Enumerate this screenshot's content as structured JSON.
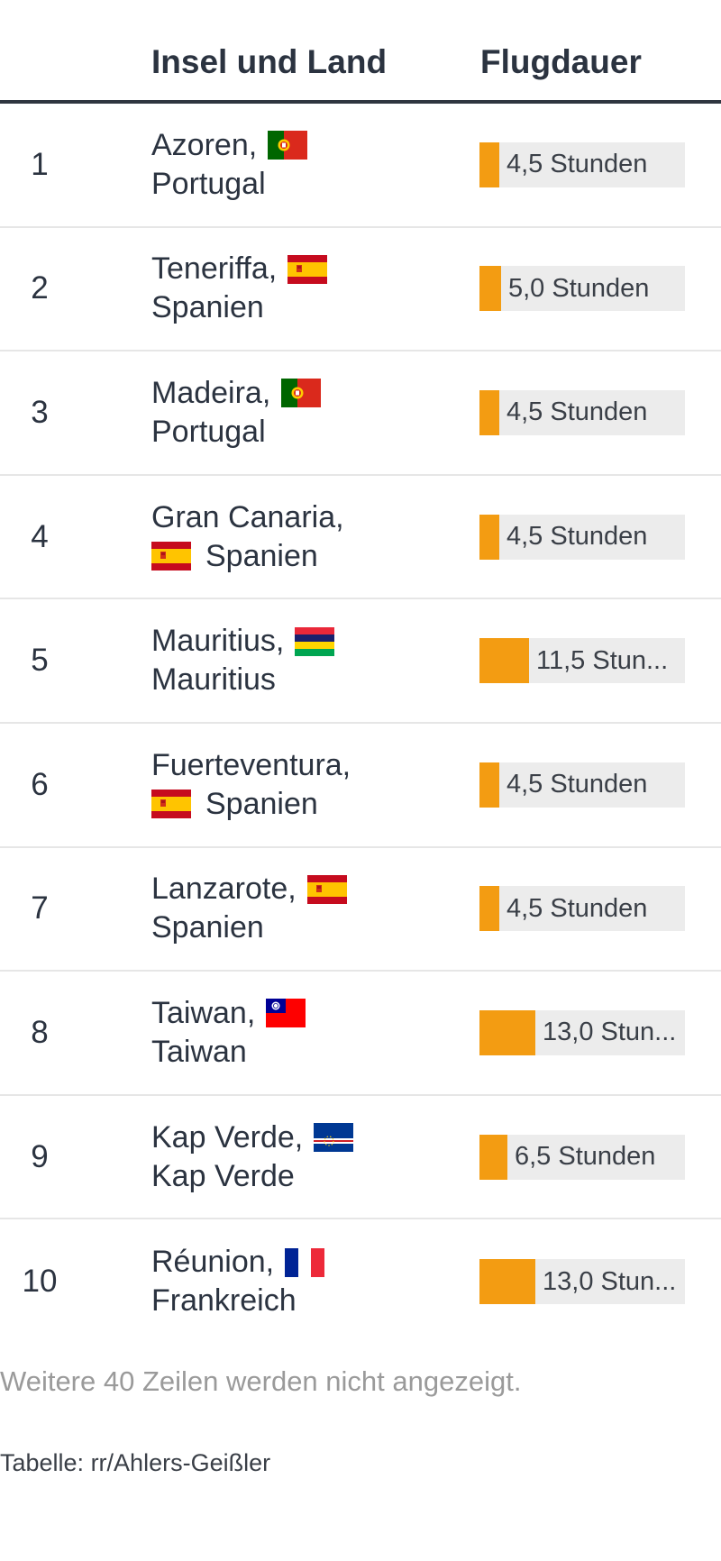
{
  "header": {
    "col_name": "Insel und Land",
    "col_duration": "Flugdauer"
  },
  "colors": {
    "bar": "#f39c12",
    "track": "#ececec"
  },
  "rows": [
    {
      "rank": "1",
      "island": "Azoren,",
      "country": "Portugal",
      "flag": "pt-flag-icon",
      "duration_hours": 4.5,
      "label": "4,5 Stunden"
    },
    {
      "rank": "2",
      "island": "Teneriffa,",
      "country": "Spanien",
      "flag": "es-flag-icon",
      "duration_hours": 5.0,
      "label": "5,0 Stunden"
    },
    {
      "rank": "3",
      "island": "Madeira,",
      "country": "Portugal",
      "flag": "pt-flag-icon",
      "duration_hours": 4.5,
      "label": "4,5 Stunden"
    },
    {
      "rank": "4",
      "island": "Gran Canaria,",
      "country": "Spanien",
      "flag": "es-flag-icon",
      "duration_hours": 4.5,
      "label": "4,5 Stunden"
    },
    {
      "rank": "5",
      "island": "Mauritius,",
      "country": "Mauritius",
      "flag": "mu-flag-icon",
      "duration_hours": 11.5,
      "label": "11,5 Stun..."
    },
    {
      "rank": "6",
      "island": "Fuerteventura,",
      "country": "Spanien",
      "flag": "es-flag-icon",
      "duration_hours": 4.5,
      "label": "4,5 Stunden"
    },
    {
      "rank": "7",
      "island": "Lanzarote,",
      "country": "Spanien",
      "flag": "es-flag-icon",
      "duration_hours": 4.5,
      "label": "4,5 Stunden"
    },
    {
      "rank": "8",
      "island": "Taiwan,",
      "country": "Taiwan",
      "flag": "tw-flag-icon",
      "duration_hours": 13.0,
      "label": "13,0 Stun..."
    },
    {
      "rank": "9",
      "island": "Kap Verde,",
      "country": "Kap Verde",
      "flag": "cv-flag-icon",
      "duration_hours": 6.5,
      "label": "6,5 Stunden"
    },
    {
      "rank": "10",
      "island": "Réunion,",
      "country": "Frankreich",
      "flag": "fr-flag-icon",
      "duration_hours": 13.0,
      "label": "13,0 Stun..."
    }
  ],
  "footer": {
    "note": "Weitere 40 Zeilen werden nicht angezeigt.",
    "source": "Tabelle: rr/Ahlers-Geißler"
  }
}
